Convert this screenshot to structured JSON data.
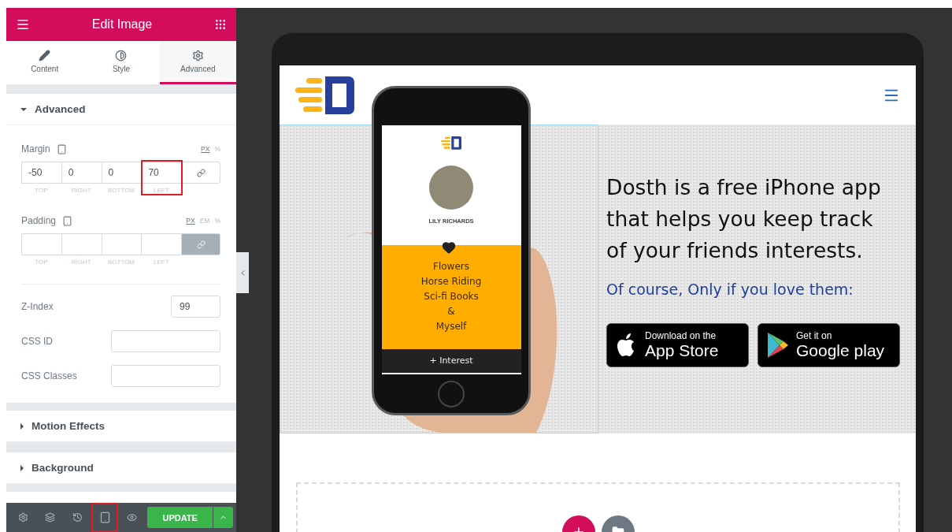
{
  "panel": {
    "title": "Edit Image",
    "tabs": [
      {
        "label": "Content",
        "selected": false
      },
      {
        "label": "Style",
        "selected": false
      },
      {
        "label": "Advanced",
        "selected": true
      }
    ],
    "section": {
      "title": "Advanced",
      "expanded": true
    },
    "margin": {
      "label": "Margin",
      "units": [
        {
          "label": "PX",
          "selected": true
        },
        {
          "label": "%",
          "selected": false
        }
      ],
      "linked": false,
      "fields": [
        {
          "value": "-50",
          "caption": "TOP",
          "highlighted": false
        },
        {
          "value": "0",
          "caption": "RIGHT",
          "highlighted": false
        },
        {
          "value": "0",
          "caption": "BOTTOM",
          "highlighted": false
        },
        {
          "value": "70",
          "caption": "LEFT",
          "highlighted": true
        }
      ]
    },
    "padding": {
      "label": "Padding",
      "units": [
        {
          "label": "PX",
          "selected": true
        },
        {
          "label": "EM",
          "selected": false
        },
        {
          "label": "%",
          "selected": false
        }
      ],
      "linked": true,
      "fields": [
        {
          "caption": "TOP",
          "highlighted": false
        },
        {
          "caption": "RIGHT",
          "highlighted": false
        },
        {
          "caption": "BOTTOM",
          "highlighted": false
        },
        {
          "caption": "LEFT",
          "highlighted": false
        }
      ]
    },
    "z_index": {
      "label": "Z-Index",
      "value": "99"
    },
    "css_id": {
      "label": "CSS ID"
    },
    "css_classes": {
      "label": "CSS Classes"
    },
    "collapsed_sections": [
      {
        "title": "Motion Effects",
        "expanded": false
      },
      {
        "title": "Background",
        "expanded": false
      }
    ],
    "footer": {
      "tools": [
        {
          "highlighted": false
        },
        {
          "highlighted": false
        },
        {
          "highlighted": false
        },
        {
          "highlighted": true
        },
        {
          "highlighted": false
        }
      ],
      "update_label": "UPDATE"
    }
  },
  "preview": {
    "phone": {
      "name": "LILY RICHARDS",
      "interests": [
        "Flowers",
        "Horse Riding",
        "Sci-fi Books",
        "&",
        "Myself"
      ],
      "add_label": "+ Interest"
    },
    "headline": "Dosth is a free iPhone app that helps you keep track of your friends interests.",
    "tagline": "Of course, Only if you love them:",
    "store_buttons": [
      {
        "kind": "apple",
        "small": "Download on the",
        "large": "App Store"
      },
      {
        "kind": "google",
        "small": "Get it on",
        "large": "Google play"
      }
    ]
  }
}
